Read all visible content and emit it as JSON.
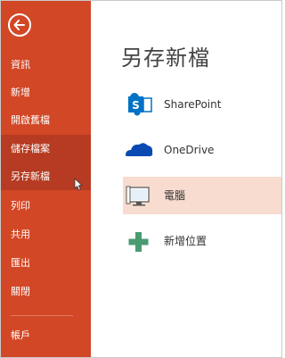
{
  "sidebar": {
    "back_icon": "back-arrow-icon",
    "items": [
      {
        "label": "資訊"
      },
      {
        "label": "新增"
      },
      {
        "label": "開啟舊檔"
      },
      {
        "label": "儲存檔案"
      },
      {
        "label": "另存新檔"
      },
      {
        "label": "列印"
      },
      {
        "label": "共用"
      },
      {
        "label": "匯出"
      },
      {
        "label": "關閉"
      },
      {
        "label": "帳戶"
      }
    ],
    "active_index": 3,
    "hovered_index": 4
  },
  "main": {
    "title": "另存新檔",
    "locations": [
      {
        "label": "SharePoint",
        "icon": "sharepoint-icon"
      },
      {
        "label": "OneDrive",
        "icon": "onedrive-icon"
      },
      {
        "label": "電腦",
        "icon": "computer-icon",
        "selected": true
      },
      {
        "label": "新增位置",
        "icon": "add-place-icon"
      }
    ]
  },
  "colors": {
    "sidebar_bg": "#d24726",
    "sidebar_active": "#b63b22",
    "selected_location_bg": "#f8dccf",
    "sharepoint_blue": "#0072c6",
    "onedrive_blue": "#094ab2",
    "add_green": "#4b9b72"
  }
}
